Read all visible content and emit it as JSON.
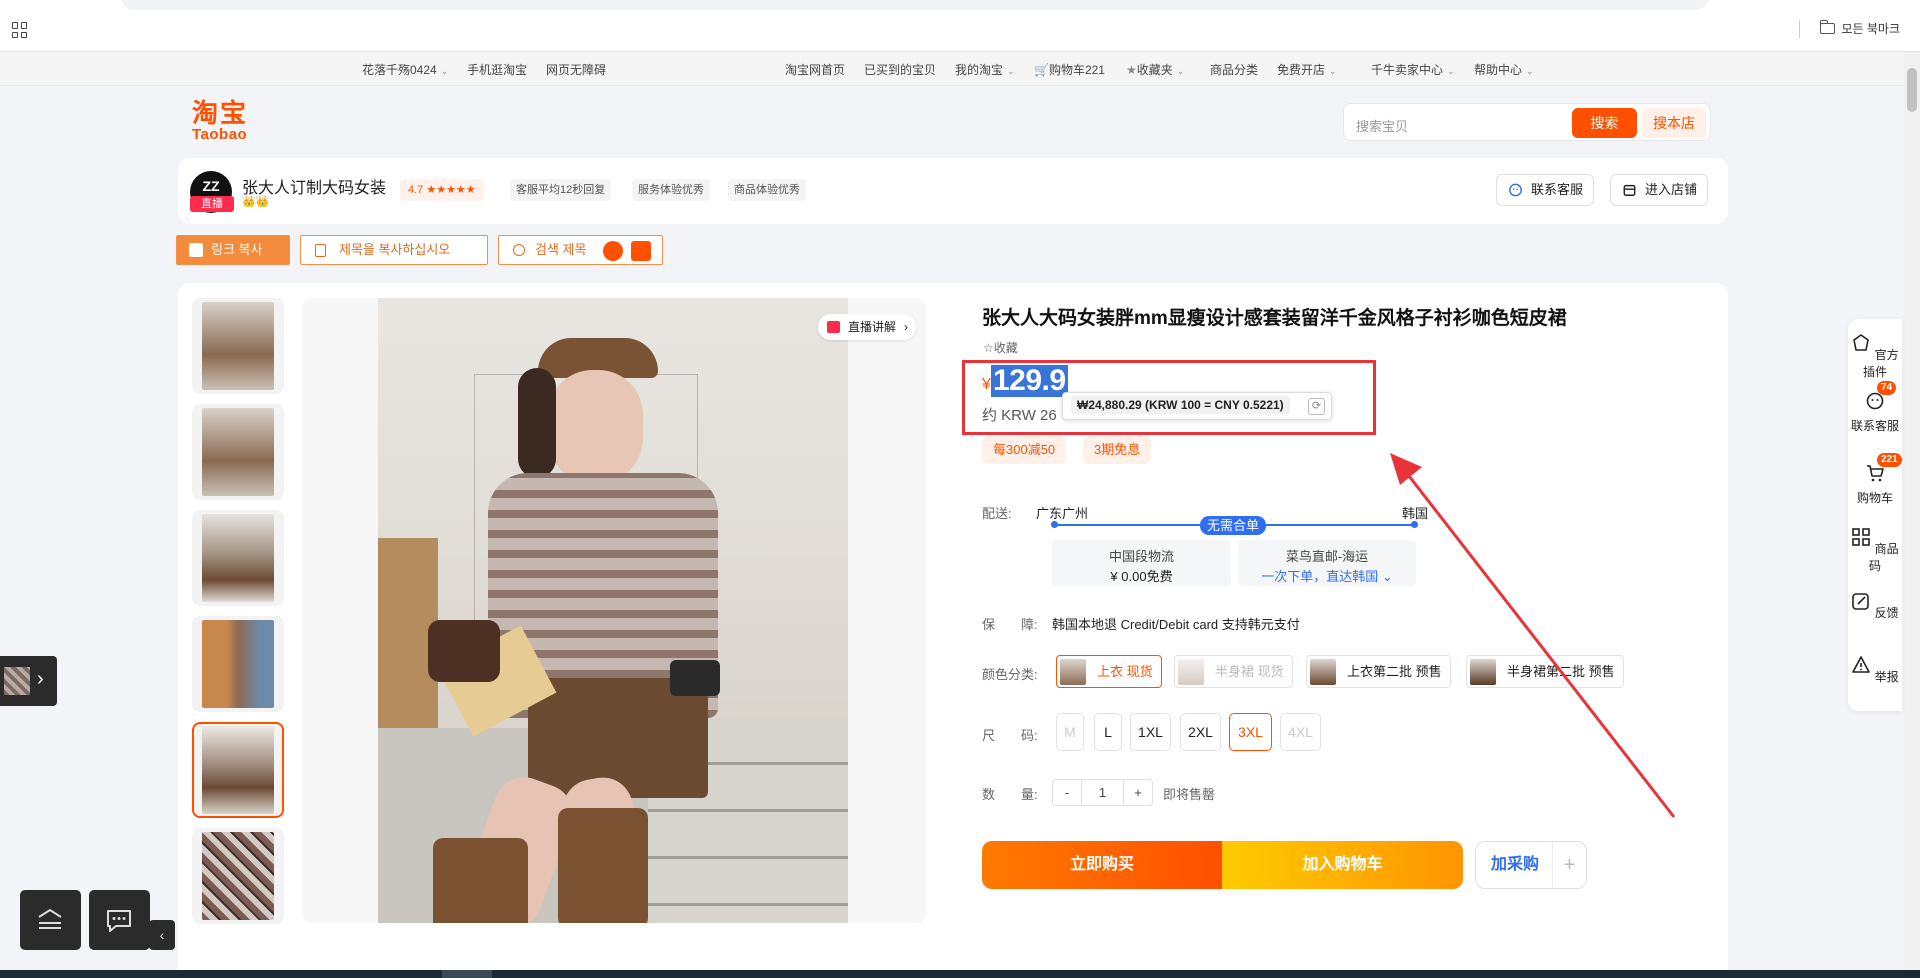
{
  "browser": {
    "bookmarks_label": "모든 북마크"
  },
  "topnav": {
    "user": "花落千殇0424",
    "mobile": "手机逛淘宝",
    "accessibility": "网页无障碍",
    "home": "淘宝网首页",
    "bought": "已买到的宝贝",
    "my_taobao": "我的淘宝",
    "cart": "购物车221",
    "favorites": "收藏夹",
    "categories": "商品分类",
    "free_shop": "免费开店",
    "seller_center": "千牛卖家中心",
    "help": "帮助中心"
  },
  "header": {
    "logo_cn": "淘宝",
    "logo_en": "Taobao",
    "search_placeholder": "搜索宝贝",
    "search_button": "搜索",
    "search_shop_button": "搜本店"
  },
  "shop": {
    "avatar_text": "ZZ",
    "live_label": "直播",
    "name": "张大人订制大码女装",
    "crowns": "👑👑",
    "rating": "4.7 ★★★★★",
    "tags": [
      "客服平均12秒回复",
      "服务体验优秀",
      "商品体验优秀"
    ],
    "contact_button": "联系客服",
    "enter_shop_button": "进入店铺"
  },
  "copybar": {
    "copy_link": "링크 복사",
    "copy_title": "제목을 복사하십시오",
    "search_title": "검색 제목"
  },
  "product": {
    "live_explain": "直播讲解",
    "title": "张大人大码女装胖mm显瘦设计感套装留洋千金风格子衬衫咖色短皮裙",
    "favorite": "收藏",
    "currency": "¥",
    "price": "129.9",
    "krw_approx": "约 KRW 26",
    "krw_popup": "₩24,880.29 (KRW 100 = CNY 0.5221)",
    "promos": [
      "每300减50",
      "3期免息"
    ],
    "shipping": {
      "label": "配送:",
      "from": "广东广州",
      "to": "韩国",
      "badge": "无需合单",
      "option1_title": "中国段物流",
      "option1_value": "¥ 0.00免费",
      "option2_title": "菜鸟直邮-海运",
      "option2_value": "一次下单，直达韩国"
    },
    "guarantee": {
      "label": "保　　障:",
      "text": "韩国本地退 Credit/Debit card 支持韩元支付"
    },
    "color": {
      "label": "颜色分类:",
      "options": [
        "上衣 现货",
        "半身裙 现货",
        "上衣第二批 预售",
        "半身裙第二批 预售"
      ]
    },
    "size": {
      "label": "尺　　码:",
      "options": [
        "M",
        "L",
        "1XL",
        "2XL",
        "3XL",
        "4XL"
      ]
    },
    "quantity": {
      "label": "数　　量:",
      "minus": "-",
      "value": "1",
      "plus": "+",
      "note": "即将售罄"
    },
    "buy_now": "立即购买",
    "add_cart": "加入购物车",
    "purchase": "加采购",
    "purchase_plus": "+"
  },
  "sidebar": {
    "items": [
      {
        "label": "官方插件"
      },
      {
        "label": "联系客服",
        "badge": "74"
      },
      {
        "label": "购物车",
        "badge": "221"
      },
      {
        "label": "商品码"
      },
      {
        "label": "反馈"
      },
      {
        "label": "举报"
      }
    ]
  },
  "colors": {
    "brand": "#ff5000",
    "link": "#2f6ef1",
    "annotation": "#e8333a"
  }
}
